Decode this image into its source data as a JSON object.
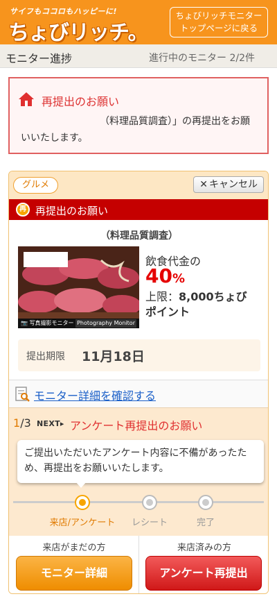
{
  "header": {
    "tagline": "サイフもココロもハッピーに!",
    "logo": "ちょびリッチ。",
    "top_button": [
      "ちょびリッチモニター",
      "トップページに戻る"
    ]
  },
  "subbar": {
    "title": "モニター進捗",
    "count": "進行中のモニター 2/2件"
  },
  "alert": {
    "title": "再提出のお願い",
    "text": "（料理品質調査）」の再提出をお願いいたします。"
  },
  "card": {
    "genre": "グルメ",
    "cancel": "キャンセル",
    "banner_icon": "再",
    "banner": "再提出のお願い",
    "survey_name": "（料理品質調査）",
    "photo_caption": "写真撮影モニター",
    "photo_caption_en": "Photography Monitor",
    "reward_label": "飲食代金の",
    "reward_percent": "40",
    "reward_unit": "%",
    "reward_limit_prefix": "上限：",
    "reward_limit_value": "8,000ちょび",
    "reward_limit_suffix": "ポイント",
    "deadline_label": "提出期限",
    "deadline_value": "11月18日",
    "detail_link": "モニター詳細を確認する"
  },
  "steps": {
    "current": "1",
    "total": "/3",
    "next_label": "NEXT▸",
    "title": "アンケート再提出のお願い",
    "message": "ご提出いただいたアンケート内容に不備があったため、再提出をお願いいたします。",
    "items": [
      {
        "label": "来店/アンケート"
      },
      {
        "label": "レシート"
      },
      {
        "label": "完了"
      }
    ],
    "active_index": 0
  },
  "actions": {
    "left_label": "来店がまだの方",
    "left_button": "モニター詳細",
    "right_label": "来店済みの方",
    "right_button": "アンケート再提出"
  },
  "colors": {
    "brand_orange": "#f7941d",
    "alert_red": "#c50000",
    "link_blue": "#1a5fc8"
  }
}
